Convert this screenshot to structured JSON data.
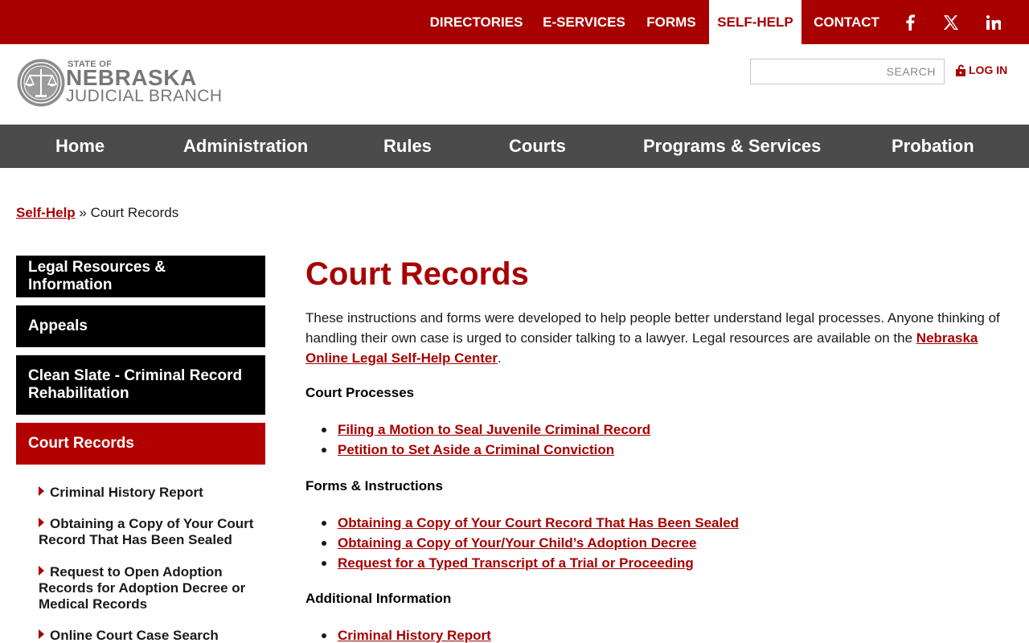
{
  "topnav": {
    "items": [
      {
        "label": "DIRECTORIES"
      },
      {
        "label": "E-SERVICES"
      },
      {
        "label": "FORMS"
      },
      {
        "label": "SELF-HELP",
        "active": true
      },
      {
        "label": "CONTACT"
      }
    ],
    "social": [
      "facebook-icon",
      "x-twitter-icon",
      "linkedin-icon"
    ]
  },
  "header": {
    "logo_small": "STATE OF",
    "logo_big": "NEBRASKA",
    "logo_sub": "JUDICIAL BRANCH",
    "search_placeholder": "SEARCH",
    "login_label": "LOG IN"
  },
  "mainnav": {
    "items": [
      {
        "label": "Home"
      },
      {
        "label": "Administration"
      },
      {
        "label": "Rules"
      },
      {
        "label": "Courts"
      },
      {
        "label": "Programs & Services"
      },
      {
        "label": "Probation"
      }
    ]
  },
  "breadcrumb": {
    "parent": "Self-Help",
    "separator": "»",
    "current": "Court Records"
  },
  "sidebar": {
    "items": [
      {
        "label": "Legal Resources & Information"
      },
      {
        "label": "Appeals"
      },
      {
        "label": "Clean Slate - Criminal Record Rehabilitation"
      },
      {
        "label": "Court Records",
        "active": true
      }
    ],
    "subitems": [
      {
        "label": "Criminal History Report"
      },
      {
        "label": "Obtaining a Copy of Your Court Record That Has Been Sealed"
      },
      {
        "label": "Request to Open Adoption Records for Adoption Decree or Medical Records"
      },
      {
        "label": "Online Court Case Search"
      }
    ]
  },
  "content": {
    "title": "Court Records",
    "intro_text": "These instructions and forms were developed to help people better understand legal processes. Anyone thinking of handling their own case is urged to consider talking to a lawyer. Legal resources are available on the ",
    "intro_link": "Nebraska Online Legal Self-Help Center",
    "intro_end": ".",
    "sections": [
      {
        "heading": "Court Processes",
        "links": [
          "Filing a Motion to Seal Juvenile Criminal Record",
          "Petition to Set Aside a Criminal Conviction"
        ]
      },
      {
        "heading": "Forms & Instructions",
        "links": [
          "Obtaining a Copy of Your Court Record That Has Been Sealed",
          "Obtaining a Copy of Your/Your Child’s Adoption Decree",
          "Request for a Typed Transcript of a Trial or Proceeding"
        ]
      },
      {
        "heading": "Additional Information",
        "links": [
          "Criminal History Report"
        ]
      }
    ]
  },
  "colors": {
    "brand_red": "#a80000",
    "nav_gray": "#4b4b4b",
    "sidebar_black": "#000000",
    "sidebar_active": "#b30000"
  }
}
